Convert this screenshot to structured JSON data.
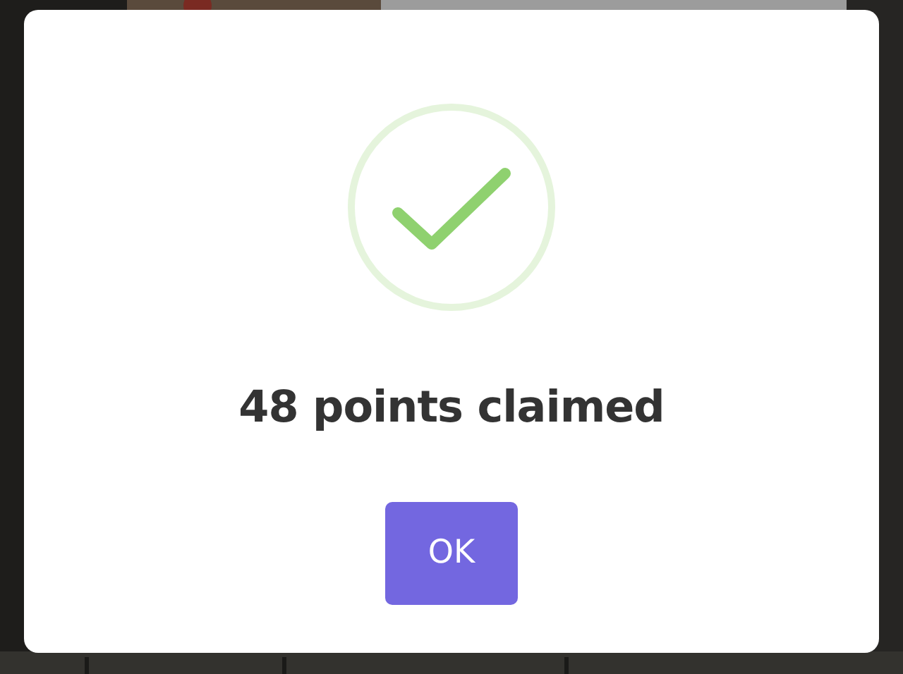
{
  "dialog": {
    "kind": "success",
    "title": "48 points claimed",
    "button": "OK"
  }
}
